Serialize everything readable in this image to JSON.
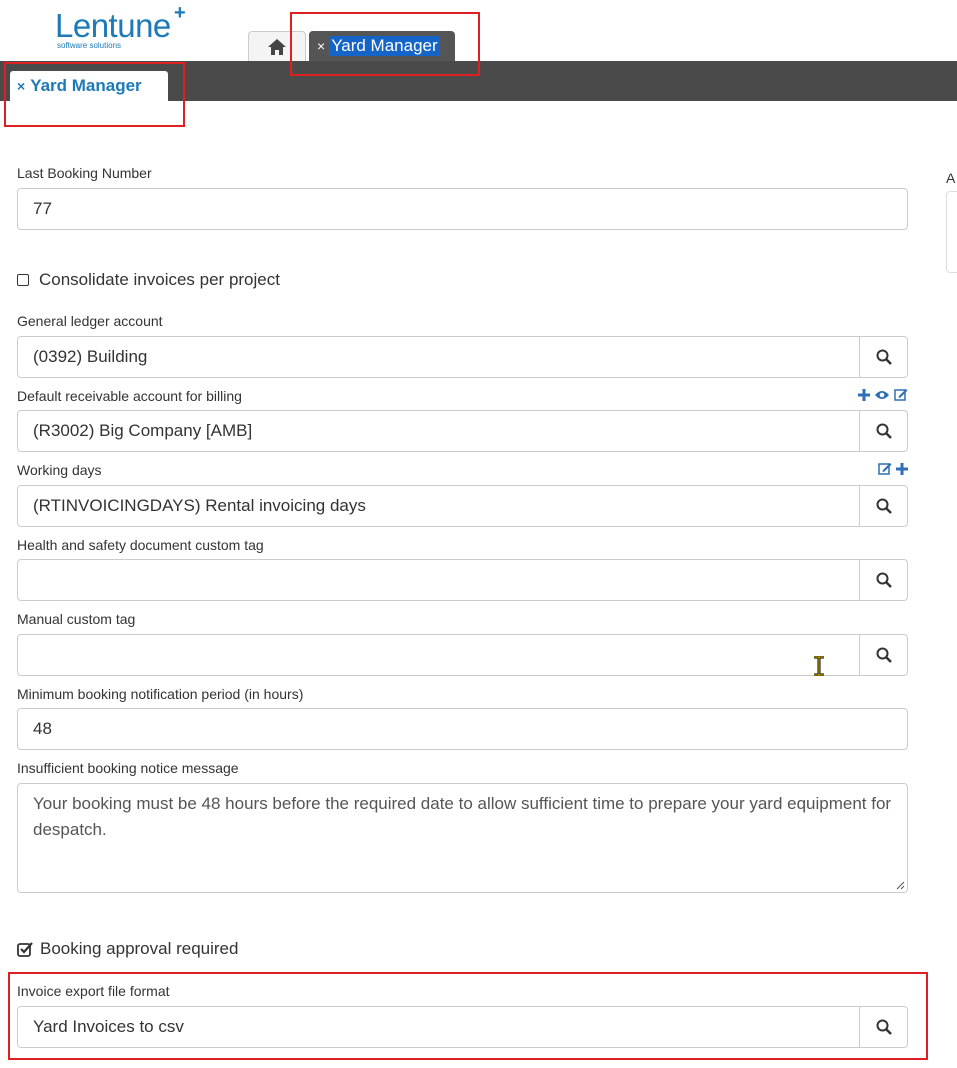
{
  "logo": {
    "name": "Lentune",
    "sub": "software solutions"
  },
  "tabs": {
    "top_active": "Yard Manager",
    "sub_active": "Yard Manager"
  },
  "icons": {
    "close": "×",
    "home": "home-icon",
    "search": "search-icon"
  },
  "form": {
    "last_booking_number": {
      "label": "Last Booking Number",
      "value": "77"
    },
    "consolidate": {
      "label": "Consolidate invoices per project",
      "checked": false
    },
    "gl_account": {
      "label": "General ledger account",
      "value": "(0392) Building"
    },
    "receivable": {
      "label": "Default receivable account for billing",
      "value": "(R3002) Big Company [AMB]"
    },
    "working_days": {
      "label": "Working days",
      "value": "(RTINVOICINGDAYS) Rental invoicing days"
    },
    "hs_tag": {
      "label": "Health and safety document custom tag",
      "value": ""
    },
    "manual_tag": {
      "label": "Manual custom tag",
      "value": ""
    },
    "min_notice": {
      "label": "Minimum booking notification period (in hours)",
      "value": "48"
    },
    "notice_message": {
      "label": "Insufficient booking notice message",
      "value": "Your booking must be 48 hours before the required date to allow sufficient time to prepare your yard equipment for despatch."
    },
    "approval": {
      "label": "Booking approval required",
      "checked": true
    },
    "export_format": {
      "label": "Invoice export file format",
      "value": "Yard Invoices to csv"
    }
  },
  "right_panel": {
    "label": "A"
  },
  "colors": {
    "accent": "#1d7ab8",
    "dark_bar": "#4a4a4a",
    "highlight": "#e02020"
  }
}
